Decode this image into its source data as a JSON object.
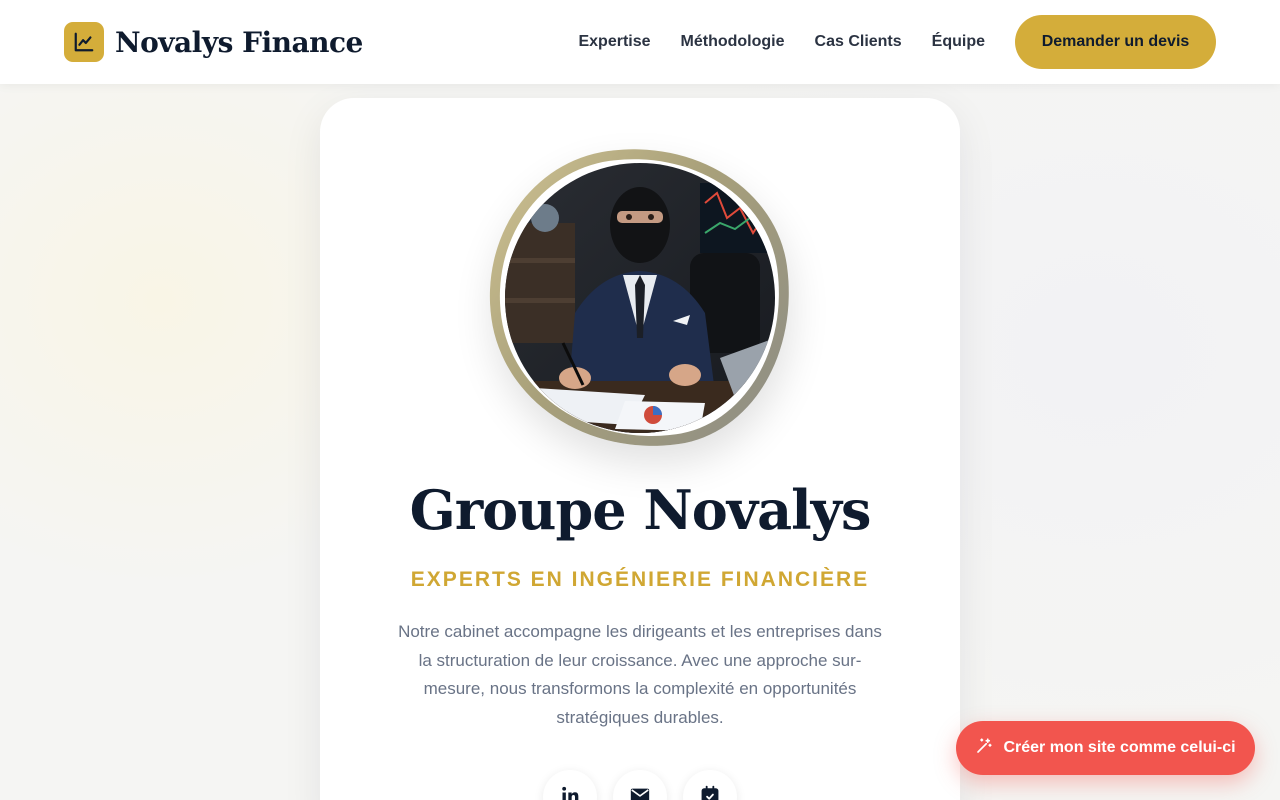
{
  "header": {
    "brand_name": "Novalys Finance",
    "logo_icon": "chart-line-icon",
    "nav": [
      {
        "label": "Expertise"
      },
      {
        "label": "Méthodologie"
      },
      {
        "label": "Cas Clients"
      },
      {
        "label": "Équipe"
      }
    ],
    "cta_label": "Demander un devis"
  },
  "profile": {
    "title": "Groupe Novalys",
    "subtitle": "EXPERTS EN INGÉNIERIE FINANCIÈRE",
    "description": "Notre cabinet accompagne les dirigeants et les entreprises dans la structuration de leur croissance. Avec une approche sur-mesure, nous transformons la complexité en opportunités stratégiques durables.",
    "social_icons": [
      "linkedin-icon",
      "mail-icon",
      "calendar-check-icon"
    ]
  },
  "floating_cta": {
    "label": "Créer mon site comme celui-ci",
    "icon": "magic-wand-icon"
  },
  "colors": {
    "accent_gold": "#d4ad3a",
    "navy": "#0f1b2e",
    "float_red": "#f2554e",
    "body_text": "#697386"
  }
}
